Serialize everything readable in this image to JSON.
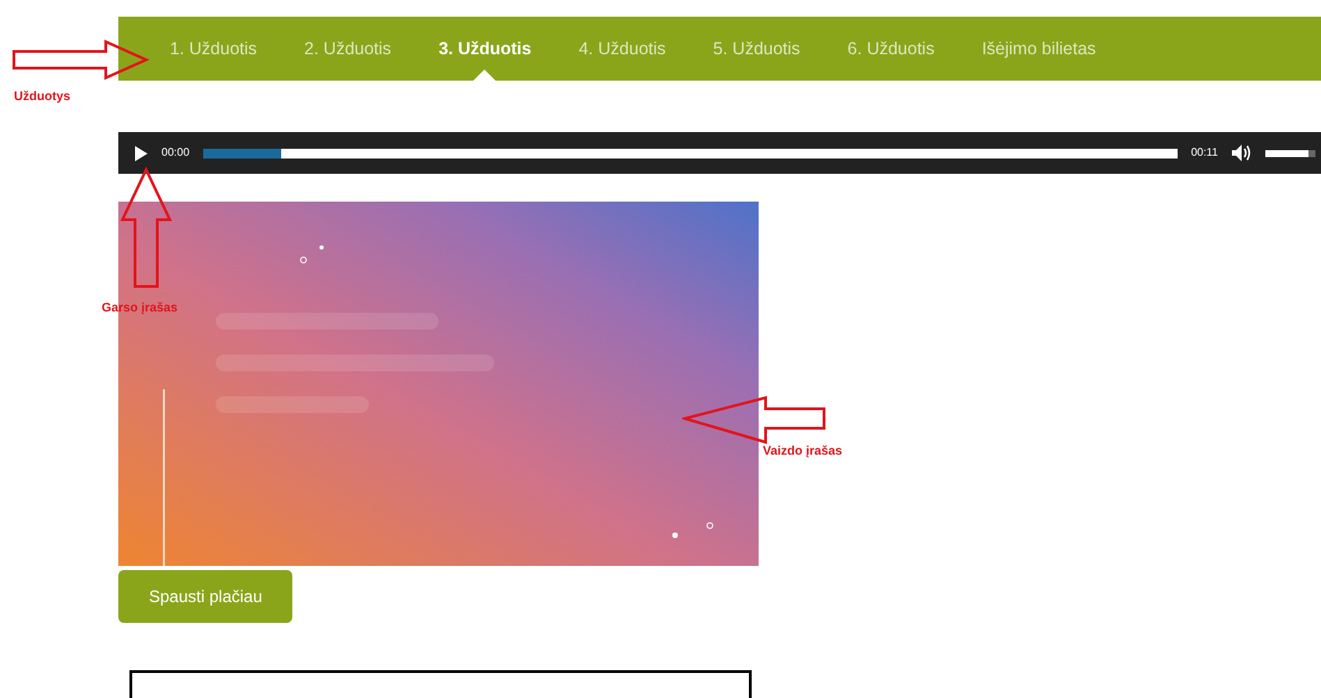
{
  "tabs": [
    {
      "label": "1. Užduotis",
      "selected": false
    },
    {
      "label": "2. Užduotis",
      "selected": false
    },
    {
      "label": "3. Užduotis",
      "selected": true
    },
    {
      "label": "4. Užduotis",
      "selected": false
    },
    {
      "label": "5. Užduotis",
      "selected": false
    },
    {
      "label": "6. Užduotis",
      "selected": false
    },
    {
      "label": "Išėjimo bilietas",
      "selected": false
    }
  ],
  "audio_player": {
    "current_time": "00:00",
    "duration": "00:11",
    "progress": {
      "level": 0.08
    },
    "volume": {
      "level": 0.85
    }
  },
  "more_button": "Spausti plačiau",
  "annotations": [
    {
      "label": "Užduotys"
    },
    {
      "label": "Garso įrašas"
    },
    {
      "label": "Vaizdo įrašas"
    }
  ]
}
